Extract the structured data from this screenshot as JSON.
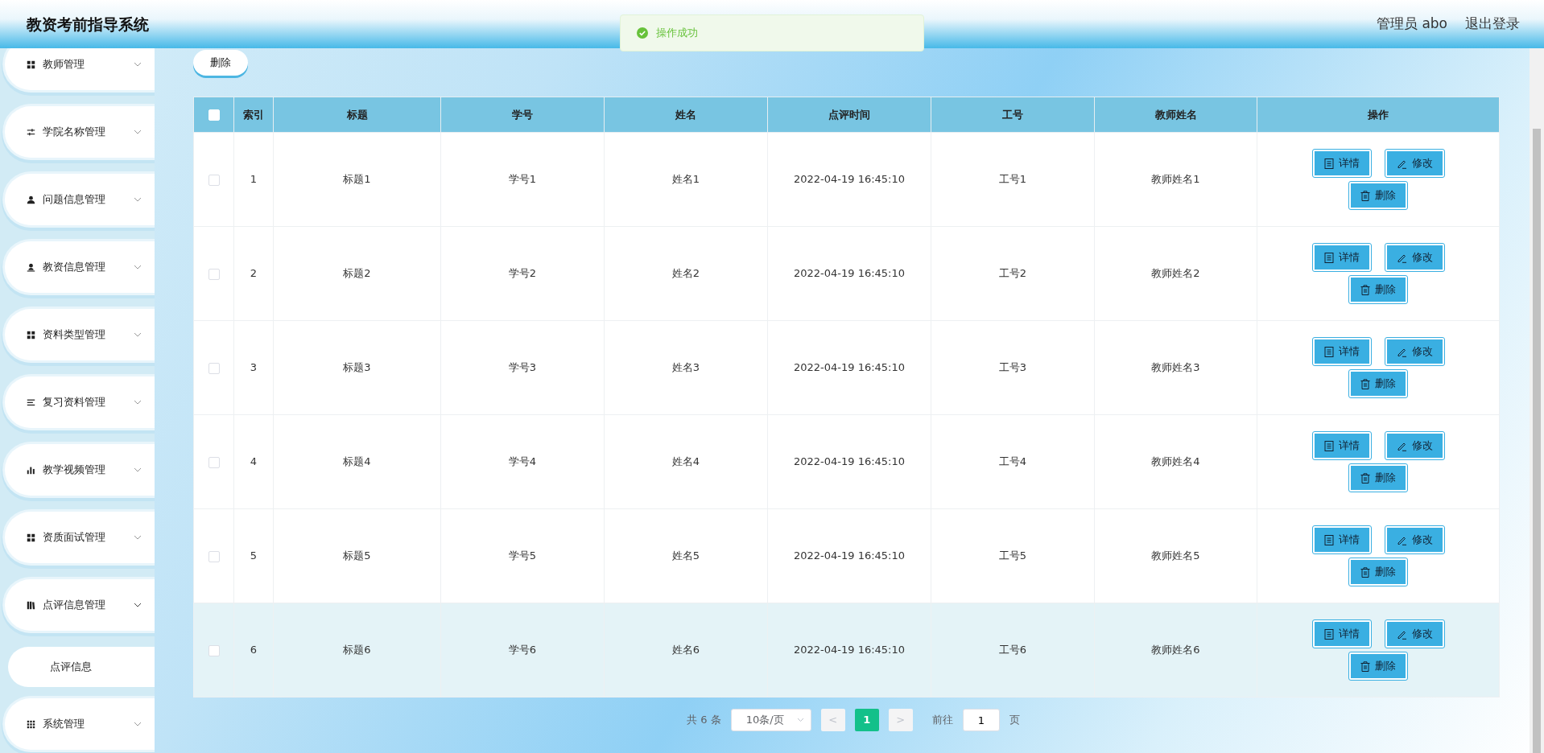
{
  "header": {
    "title": "教资考前指导系统",
    "user": "管理员 abo",
    "logout": "退出登录"
  },
  "toast": {
    "text": "操作成功"
  },
  "sidebar": {
    "items": [
      {
        "label": "教师管理",
        "expanded": false
      },
      {
        "label": "学院名称管理",
        "expanded": false
      },
      {
        "label": "问题信息管理",
        "expanded": false
      },
      {
        "label": "教资信息管理",
        "expanded": false
      },
      {
        "label": "资料类型管理",
        "expanded": false
      },
      {
        "label": "复习资料管理",
        "expanded": false
      },
      {
        "label": "教学视频管理",
        "expanded": false
      },
      {
        "label": "资质面试管理",
        "expanded": false
      },
      {
        "label": "点评信息管理",
        "expanded": true,
        "children": [
          {
            "label": "点评信息"
          }
        ]
      },
      {
        "label": "系统管理",
        "expanded": false
      }
    ]
  },
  "toolbar": {
    "delete_button": "删除"
  },
  "table": {
    "select_all": false,
    "columns": [
      "索引",
      "标题",
      "学号",
      "姓名",
      "点评时间",
      "工号",
      "教师姓名",
      "操作"
    ],
    "rows": [
      {
        "cells": [
          "1",
          "标题1",
          "学号1",
          "姓名1",
          "2022-04-19 16:45:10",
          "工号1",
          "教师姓名1"
        ],
        "actions": [
          "详情",
          "修改",
          "删除"
        ],
        "checked": false,
        "hovered": false
      },
      {
        "cells": [
          "2",
          "标题2",
          "学号2",
          "姓名2",
          "2022-04-19 16:45:10",
          "工号2",
          "教师姓名2"
        ],
        "actions": [
          "详情",
          "修改",
          "删除"
        ],
        "checked": false,
        "hovered": false
      },
      {
        "cells": [
          "3",
          "标题3",
          "学号3",
          "姓名3",
          "2022-04-19 16:45:10",
          "工号3",
          "教师姓名3"
        ],
        "actions": [
          "详情",
          "修改",
          "删除"
        ],
        "checked": false,
        "hovered": false
      },
      {
        "cells": [
          "4",
          "标题4",
          "学号4",
          "姓名4",
          "2022-04-19 16:45:10",
          "工号4",
          "教师姓名4"
        ],
        "actions": [
          "详情",
          "修改",
          "删除"
        ],
        "checked": false,
        "hovered": false
      },
      {
        "cells": [
          "5",
          "标题5",
          "学号5",
          "姓名5",
          "2022-04-19 16:45:10",
          "工号5",
          "教师姓名5"
        ],
        "actions": [
          "详情",
          "修改",
          "删除"
        ],
        "checked": false,
        "hovered": false
      },
      {
        "cells": [
          "6",
          "标题6",
          "学号6",
          "姓名6",
          "2022-04-19 16:45:10",
          "工号6",
          "教师姓名6"
        ],
        "actions": [
          "详情",
          "修改",
          "删除"
        ],
        "checked": false,
        "hovered": true
      }
    ]
  },
  "pagination": {
    "total": "共 6 条",
    "page_size": "10条/页",
    "prev": "<",
    "pages": [
      {
        "label": "1",
        "selected": true
      }
    ],
    "next": ">",
    "goto_label": "前往",
    "goto_value": "1",
    "goto_suffix": "页"
  }
}
